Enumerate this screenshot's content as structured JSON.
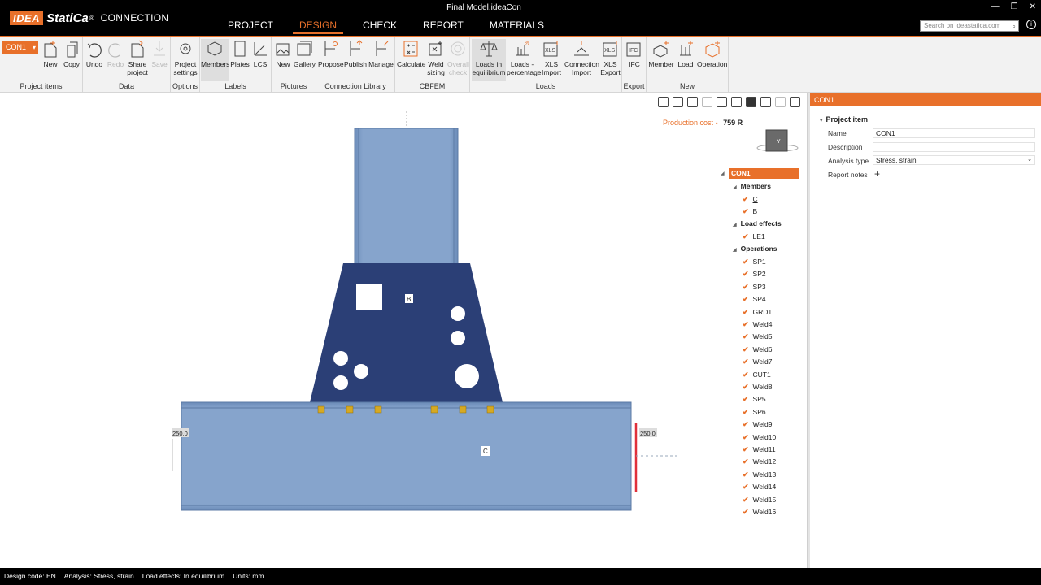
{
  "app": {
    "logo_brand": "IDEA",
    "logo_name": "StatiCa",
    "logo_reg": "®",
    "product": "CONNECTION",
    "window_title": "Final Model.ideaCon"
  },
  "main_menu": [
    {
      "label": "PROJECT",
      "active": false
    },
    {
      "label": "DESIGN",
      "active": true
    },
    {
      "label": "CHECK",
      "active": false
    },
    {
      "label": "REPORT",
      "active": false
    },
    {
      "label": "MATERIALS",
      "active": false
    }
  ],
  "search": {
    "placeholder": "Search on ideastatica.com"
  },
  "ribbon": {
    "con_select": "CON1",
    "groups": {
      "project_items": "Project items",
      "data": "Data",
      "options": "Options",
      "labels": "Labels",
      "pictures": "Pictures",
      "connection_library": "Connection Library",
      "cbfem": "CBFEM",
      "loads": "Loads",
      "export": "Export",
      "new": "New"
    },
    "buttons": {
      "new": "New",
      "copy": "Copy",
      "undo": "Undo",
      "redo": "Redo",
      "share_project": "Share project",
      "save": "Save",
      "project_settings": "Project settings",
      "members": "Members",
      "plates": "Plates",
      "lcs": "LCS",
      "pic_new": "New",
      "gallery": "Gallery",
      "propose": "Propose",
      "publish": "Publish",
      "manage": "Manage",
      "calculate": "Calculate",
      "weld_sizing": "Weld sizing",
      "overall_check": "Overall check",
      "loads_in_equilibrium": "Loads in equilibrium",
      "loads_percentage": "Loads - percentage",
      "xls_import": "XLS Import",
      "connection_import": "Connection Import",
      "xls_export": "XLS Export",
      "ifc": "IFC",
      "member": "Member",
      "load": "Load",
      "operation": "Operation"
    }
  },
  "canvas": {
    "production_cost_label": "Production cost",
    "production_cost_sep": "-",
    "production_cost_value": "759 R",
    "label_b": "B",
    "label_c": "C",
    "dim_left": "250.0",
    "dim_right": "250.0",
    "cube_label": "Y"
  },
  "tree": {
    "root": "CON1",
    "members_label": "Members",
    "members": [
      "C",
      "B"
    ],
    "load_effects_label": "Load effects",
    "load_effects": [
      "LE1"
    ],
    "operations_label": "Operations",
    "operations": [
      "SP1",
      "SP2",
      "SP3",
      "SP4",
      "GRD1",
      "Weld4",
      "Weld5",
      "Weld6",
      "Weld7",
      "CUT1",
      "Weld8",
      "SP5",
      "SP6",
      "Weld9",
      "Weld10",
      "Weld11",
      "Weld12",
      "Weld13",
      "Weld14",
      "Weld15",
      "Weld16"
    ]
  },
  "properties": {
    "header": "CON1",
    "section": "Project item",
    "name_label": "Name",
    "name_value": "CON1",
    "description_label": "Description",
    "description_value": "",
    "analysis_type_label": "Analysis type",
    "analysis_type_value": "Stress, strain",
    "report_notes_label": "Report notes"
  },
  "statusbar": {
    "design_code": "Design code: EN",
    "analysis": "Analysis: Stress, strain",
    "load_effects": "Load effects: In equilibrium",
    "units": "Units: mm"
  },
  "colors": {
    "accent": "#e8702a",
    "plate": "#2b3f76",
    "member": "#7c9cc6"
  }
}
